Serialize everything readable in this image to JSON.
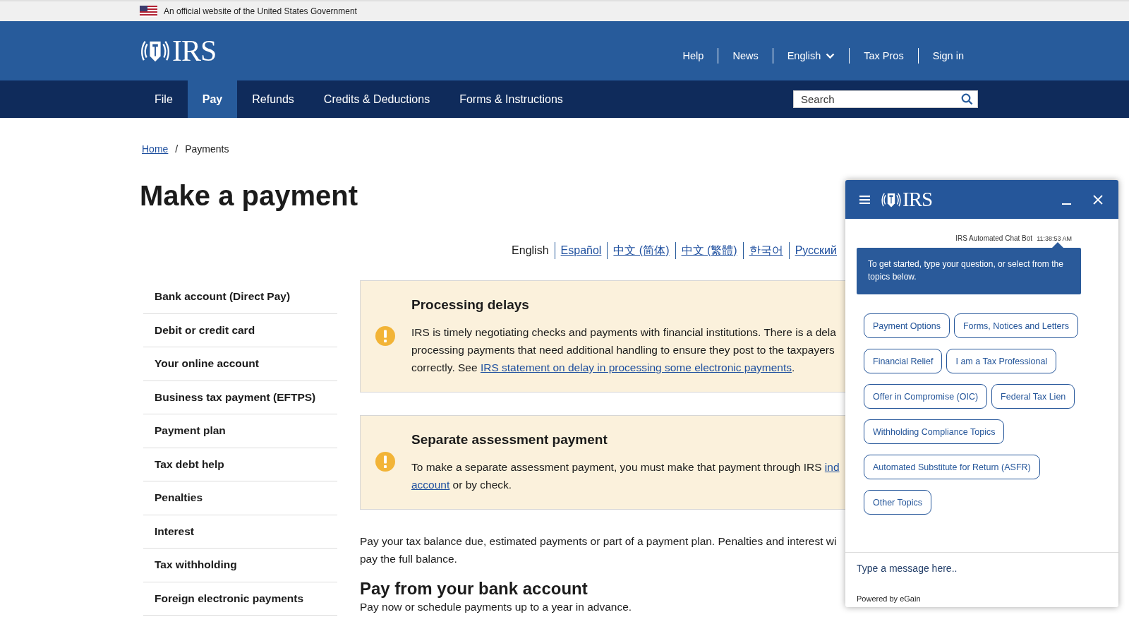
{
  "gov_banner": {
    "text": "An official website of the United States Government"
  },
  "header": {
    "logo": "IRS",
    "utility_links": [
      {
        "label": "Help",
        "kind": "link"
      },
      {
        "label": "News",
        "kind": "link"
      },
      {
        "label": "English",
        "kind": "dropdown"
      },
      {
        "label": "Tax Pros",
        "kind": "link"
      },
      {
        "label": "Sign in",
        "kind": "link"
      }
    ]
  },
  "nav": {
    "tabs": [
      {
        "label": "File",
        "selected": false
      },
      {
        "label": "Pay",
        "selected": true
      },
      {
        "label": "Refunds",
        "selected": false
      },
      {
        "label": "Credits & Deductions",
        "selected": false
      },
      {
        "label": "Forms & Instructions",
        "selected": false
      }
    ],
    "search": {
      "placeholder": "Search"
    }
  },
  "breadcrumb": {
    "items": [
      {
        "label": "Home",
        "kind": "link"
      },
      {
        "label": "Payments",
        "kind": "current"
      }
    ],
    "separator": "/"
  },
  "title": "Make a payment",
  "languages": [
    {
      "label": "English",
      "selected": true
    },
    {
      "label": "Español",
      "selected": false
    },
    {
      "label": "中文 (简体)",
      "selected": false
    },
    {
      "label": "中文 (繁體)",
      "selected": false
    },
    {
      "label": "한국어",
      "selected": false
    },
    {
      "label": "Русский",
      "selected": false
    }
  ],
  "sidebar": {
    "items": [
      "Bank account (Direct Pay)",
      "Debit or credit card",
      "Your online account",
      "Business tax payment (EFTPS)",
      "Payment plan",
      "Tax debt help",
      "Penalties",
      "Interest",
      "Tax withholding",
      "Foreign electronic payments"
    ]
  },
  "alerts": [
    {
      "title": "Processing delays",
      "segments": [
        {
          "kind": "text",
          "text": "IRS is timely negotiating checks and payments with financial institutions. There is a dela"
        },
        {
          "kind": "break"
        },
        {
          "kind": "text",
          "text": "processing payments that need additional handling to ensure they post to the taxpayers"
        },
        {
          "kind": "break"
        },
        {
          "kind": "text",
          "text": "correctly. See "
        },
        {
          "kind": "link",
          "text": "IRS statement on delay in processing some electronic payments"
        },
        {
          "kind": "text",
          "text": "."
        }
      ]
    },
    {
      "title": "Separate assessment payment",
      "segments": [
        {
          "kind": "text",
          "text": "To make a separate assessment payment, you must make that payment through IRS "
        },
        {
          "kind": "link",
          "text": "ind"
        },
        {
          "kind": "break"
        },
        {
          "kind": "link",
          "text": "account"
        },
        {
          "kind": "text",
          "text": " or by check."
        }
      ]
    }
  ],
  "intro": {
    "segments": [
      {
        "kind": "text",
        "text": "Pay your tax balance due, estimated payments or part of a payment plan. Penalties and interest wi"
      },
      {
        "kind": "break"
      },
      {
        "kind": "text",
        "text": "pay the full balance."
      }
    ]
  },
  "section": {
    "heading": "Pay from your bank account",
    "text": "Pay now or schedule payments up to a year in advance."
  },
  "chat": {
    "logo": "IRS",
    "sender": "IRS Automated Chat Bot",
    "time": "11:38:53 AM",
    "message": "To get started, type your question, or select from the topics below.",
    "topics": [
      "Payment Options",
      "Forms, Notices and Letters",
      "Financial Relief",
      "I am a Tax Professional",
      "Offer in Compromise (OIC)",
      "Federal Tax Lien",
      "Withholding Compliance Topics",
      "Automated Substitute for Return (ASFR)",
      "Other Topics"
    ],
    "input": {
      "placeholder": "Type a message here.."
    },
    "footer": "Powered by eGain"
  }
}
